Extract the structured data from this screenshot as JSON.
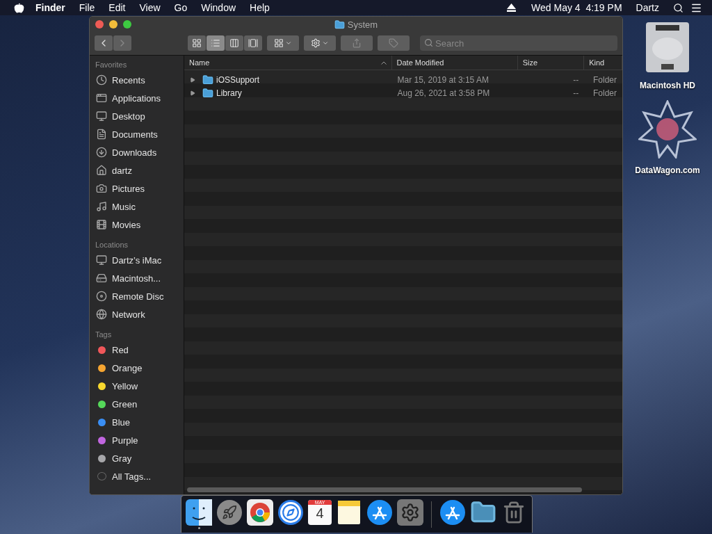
{
  "menubar": {
    "app_name": "Finder",
    "menus": [
      "File",
      "Edit",
      "View",
      "Go",
      "Window",
      "Help"
    ],
    "datetime": "Wed May 4  4:19 PM",
    "user": "Dartz"
  },
  "window": {
    "title": "System",
    "search": {
      "placeholder": "Search"
    },
    "view_modes": [
      {
        "kind": "icons",
        "selected": false
      },
      {
        "kind": "list",
        "selected": true
      },
      {
        "kind": "columns",
        "selected": false
      },
      {
        "kind": "gallery",
        "selected": false
      }
    ],
    "sidebar": [
      {
        "heading": "Favorites",
        "items": [
          {
            "label": "Recents",
            "kind": "recents"
          },
          {
            "label": "Applications",
            "kind": "applications"
          },
          {
            "label": "Desktop",
            "kind": "desktop"
          },
          {
            "label": "Documents",
            "kind": "documents"
          },
          {
            "label": "Downloads",
            "kind": "downloads"
          },
          {
            "label": "dartz",
            "kind": "home"
          },
          {
            "label": "Pictures",
            "kind": "pictures"
          },
          {
            "label": "Music",
            "kind": "music"
          },
          {
            "label": "Movies",
            "kind": "movies"
          }
        ]
      },
      {
        "heading": "Locations",
        "items": [
          {
            "label": "Dartz’s iMac",
            "kind": "computer"
          },
          {
            "label": "Macintosh...",
            "kind": "disk"
          },
          {
            "label": "Remote Disc",
            "kind": "disc"
          },
          {
            "label": "Network",
            "kind": "network"
          }
        ]
      },
      {
        "heading": "Tags",
        "items": [
          {
            "label": "Red",
            "kind": "tag",
            "color": "#f0575a"
          },
          {
            "label": "Orange",
            "kind": "tag",
            "color": "#f5a531"
          },
          {
            "label": "Yellow",
            "kind": "tag",
            "color": "#f8d82e"
          },
          {
            "label": "Green",
            "kind": "tag",
            "color": "#55d85a"
          },
          {
            "label": "Blue",
            "kind": "tag",
            "color": "#3a8ff5"
          },
          {
            "label": "Purple",
            "kind": "tag",
            "color": "#c166e0"
          },
          {
            "label": "Gray",
            "kind": "tag",
            "color": "#a6a6a9"
          },
          {
            "label": "All Tags...",
            "kind": "all-tags"
          }
        ]
      }
    ],
    "columns": [
      {
        "label": "Name",
        "sorted": true
      },
      {
        "label": "Date Modified",
        "sorted": false
      },
      {
        "label": "Size",
        "sorted": false
      },
      {
        "label": "Kind",
        "sorted": false
      }
    ],
    "rows": [
      {
        "name": "iOSSupport",
        "date": "Mar 15, 2019 at 3:15 AM",
        "size": "--",
        "kind": "Folder",
        "expanded": false
      },
      {
        "name": "Library",
        "date": "Aug 26, 2021 at 3:58 PM",
        "size": "--",
        "kind": "Folder",
        "expanded": false
      }
    ]
  },
  "desktop_icons": [
    {
      "label": "Macintosh HD",
      "kind": "disk"
    },
    {
      "label": "DataWagon.com",
      "kind": "star"
    }
  ],
  "dock": [
    {
      "kind": "finder",
      "running": true
    },
    {
      "kind": "launchpad",
      "running": false
    },
    {
      "kind": "chrome",
      "running": false
    },
    {
      "kind": "safari",
      "running": false
    },
    {
      "kind": "calendar",
      "month": "MAY",
      "day": "4",
      "running": false
    },
    {
      "kind": "notes",
      "running": false
    },
    {
      "kind": "appstore",
      "running": false
    },
    {
      "kind": "settings",
      "running": false
    },
    {
      "kind": "separator"
    },
    {
      "kind": "appstore",
      "running": false
    },
    {
      "kind": "folder",
      "running": false
    },
    {
      "kind": "trash",
      "running": false
    }
  ]
}
